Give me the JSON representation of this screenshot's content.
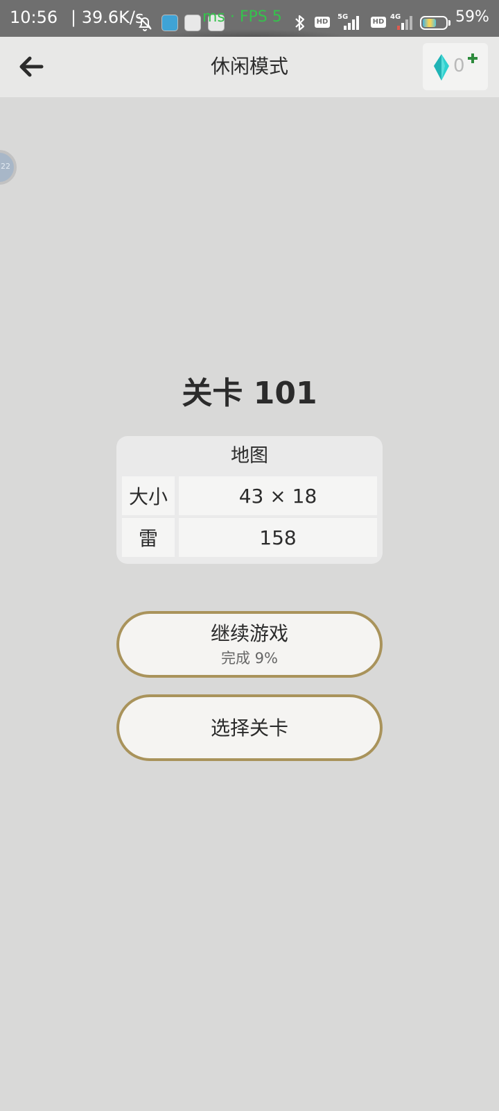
{
  "status_bar": {
    "time": "10:56",
    "network_speed": "| 39.6K/s",
    "fps_overlay": "ms · FPS 5",
    "sim1_label": "5G",
    "sim2_label": "4G",
    "hd_label": "HD",
    "battery_level": "59%",
    "battery_fraction": 0.59
  },
  "header": {
    "title": "休闲模式",
    "gem_count": "0",
    "colors": {
      "gem": "#2fd1cf",
      "plus": "#2e8b3d"
    }
  },
  "floating_bubble": {
    "label": "22"
  },
  "level": {
    "title": "关卡 101",
    "map": {
      "header": "地图",
      "rows": [
        {
          "label": "大小",
          "value": "43 × 18"
        },
        {
          "label": "雷",
          "value": "158"
        }
      ]
    }
  },
  "actions": {
    "continue_label": "继续游戏",
    "continue_progress": "完成 9%",
    "select_level_label": "选择关卡",
    "border_color": "#a9935b"
  }
}
